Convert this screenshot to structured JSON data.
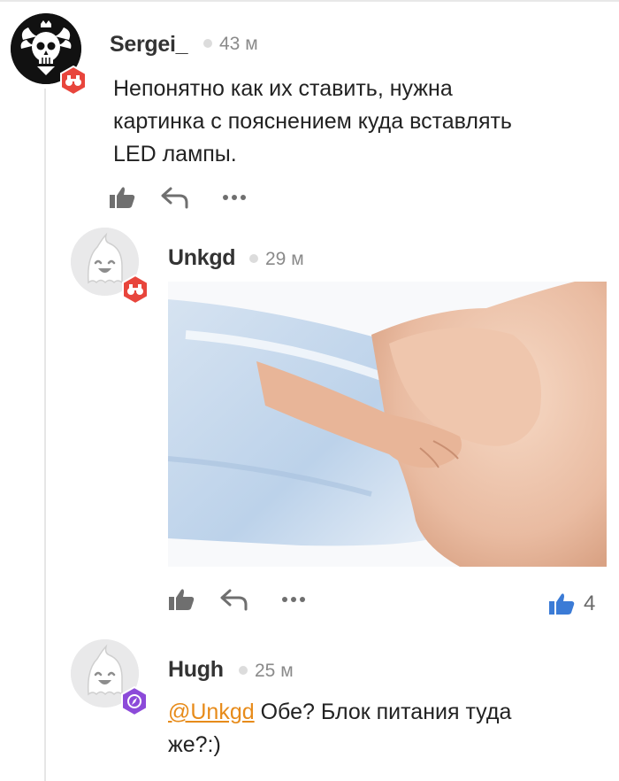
{
  "comments": [
    {
      "author": "Sergei_",
      "time": "43 м",
      "text": "Непонятно как их ставить, нужна картинка с пояснением куда вставлять LED лампы.",
      "text_lines": [
        "Непонятно как их ставить, нужна",
        "картинка с пояснением куда вставлять",
        "LED лампы."
      ],
      "avatar_icon": "skull-eagle-avatar-icon",
      "badge_icon": "binoculars-badge-icon",
      "badge_color": "#e8453c"
    },
    {
      "author": "Unkgd",
      "time": "29 м",
      "image_icon": "illustration-image",
      "avatar_icon": "ghost-avatar-icon",
      "badge_icon": "binoculars-badge-icon",
      "badge_color": "#e8453c",
      "rating": "4",
      "rating_color": "#3b7bd6"
    },
    {
      "author": "Hugh",
      "time": "25 м",
      "mention": "@Unkgd",
      "text_after_mention": " Обе? Блок питания туда",
      "text_line2": "же?:)",
      "avatar_icon": "ghost-avatar-icon",
      "badge_icon": "compass-badge-icon",
      "badge_color": "#8c4ad9"
    }
  ],
  "actions": {
    "like_icon": "thumbs-up-icon",
    "reply_icon": "reply-arrow-icon",
    "more_icon": "more-dots-icon"
  },
  "colors": {
    "accent_mention": "#e78b1a",
    "icon_gray": "#6f6f6f"
  }
}
